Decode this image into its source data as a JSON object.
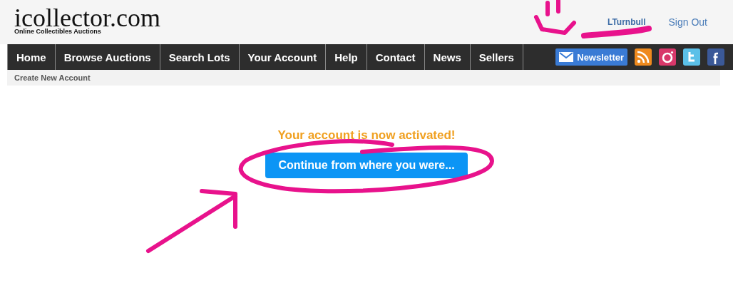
{
  "header": {
    "logo": "icollector.com",
    "tagline": "Online Collectibles Auctions",
    "user": "LTurnbull",
    "sign_out": "Sign Out"
  },
  "nav": {
    "items": [
      "Home",
      "Browse Auctions",
      "Search Lots",
      "Your Account",
      "Help",
      "Contact",
      "News",
      "Sellers"
    ],
    "newsletter": "Newsletter",
    "social": [
      {
        "kind": "rss",
        "color": "#ef8a1e"
      },
      {
        "kind": "instagram",
        "color": "#d8386a"
      },
      {
        "kind": "twitter",
        "color": "#5bc0e8"
      },
      {
        "kind": "facebook",
        "color": "#3b5998"
      }
    ]
  },
  "breadcrumb": "Create New Account",
  "message": "Your account is now activated!",
  "continue_button": "Continue from where you were..."
}
